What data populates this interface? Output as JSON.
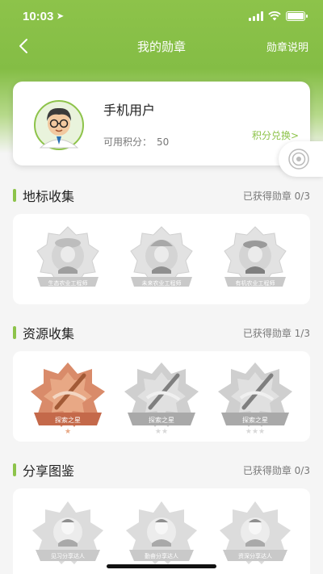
{
  "status_bar": {
    "time": "10:03"
  },
  "nav": {
    "title": "我的勋章",
    "right_label": "勋章说明"
  },
  "profile": {
    "name": "手机用户",
    "points_label": "可用积分：",
    "points_value": "50",
    "exchange_label": "积分兑换>"
  },
  "sections": [
    {
      "title": "地标收集",
      "status": "已获得勋章 0/3",
      "badges": [
        {
          "label": "生态农业工程师",
          "earned": false
        },
        {
          "label": "未来农业工程师",
          "earned": false
        },
        {
          "label": "有机农业工程师",
          "earned": false
        }
      ]
    },
    {
      "title": "资源收集",
      "status": "已获得勋章 1/3",
      "badges": [
        {
          "label": "探索之星",
          "earned": true
        },
        {
          "label": "探索之星",
          "earned": false
        },
        {
          "label": "探索之星",
          "earned": false
        }
      ]
    },
    {
      "title": "分享图鉴",
      "status": "已获得勋章 0/3",
      "badges": [
        {
          "label": "见习分享达人",
          "earned": false
        },
        {
          "label": "勤奋分享达人",
          "earned": false
        },
        {
          "label": "资深分享达人",
          "earned": false
        }
      ]
    }
  ],
  "colors": {
    "accent": "#8dc34a",
    "earned_badge": "#d98b6a",
    "locked_badge": "#cfcfcf"
  }
}
